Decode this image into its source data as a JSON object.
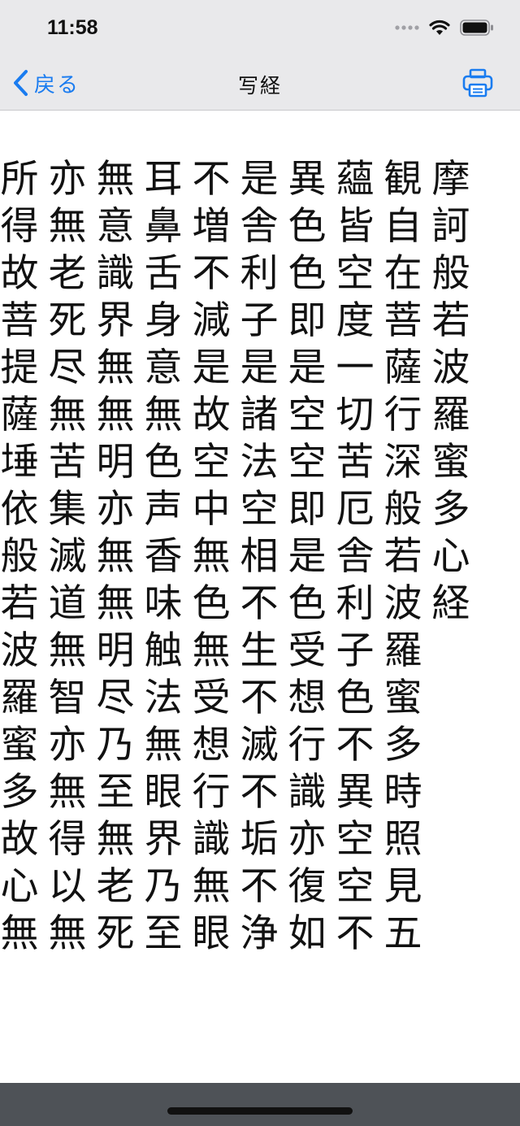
{
  "status_bar": {
    "time": "11:58",
    "icons": [
      "signal-dots-icon",
      "wifi-icon",
      "battery-icon"
    ]
  },
  "nav": {
    "back_label": "戻る",
    "title": "写経",
    "print_icon": "print-icon",
    "accent": "#1a7cf0"
  },
  "sutra": {
    "columns": [
      "摩訶般若波羅蜜多心経",
      "観自在菩薩行深般若波羅蜜多時照見五",
      "蘊皆空度一切苦厄舎利子色不異空空不",
      "異色色即是空空即是色受想行識亦復如",
      "是舎利子是諸法空相不生不滅不垢不浄",
      "不増不減是故空中無色無受想行識無眼",
      "耳鼻舌身意無色声香味触法無眼界乃至",
      "無意識界無無明亦無無明尽乃至無老死",
      "亦無老死尽無苦集滅道無智亦無得以無",
      "所得故菩提薩埵依般若波羅蜜多故心無"
    ]
  }
}
